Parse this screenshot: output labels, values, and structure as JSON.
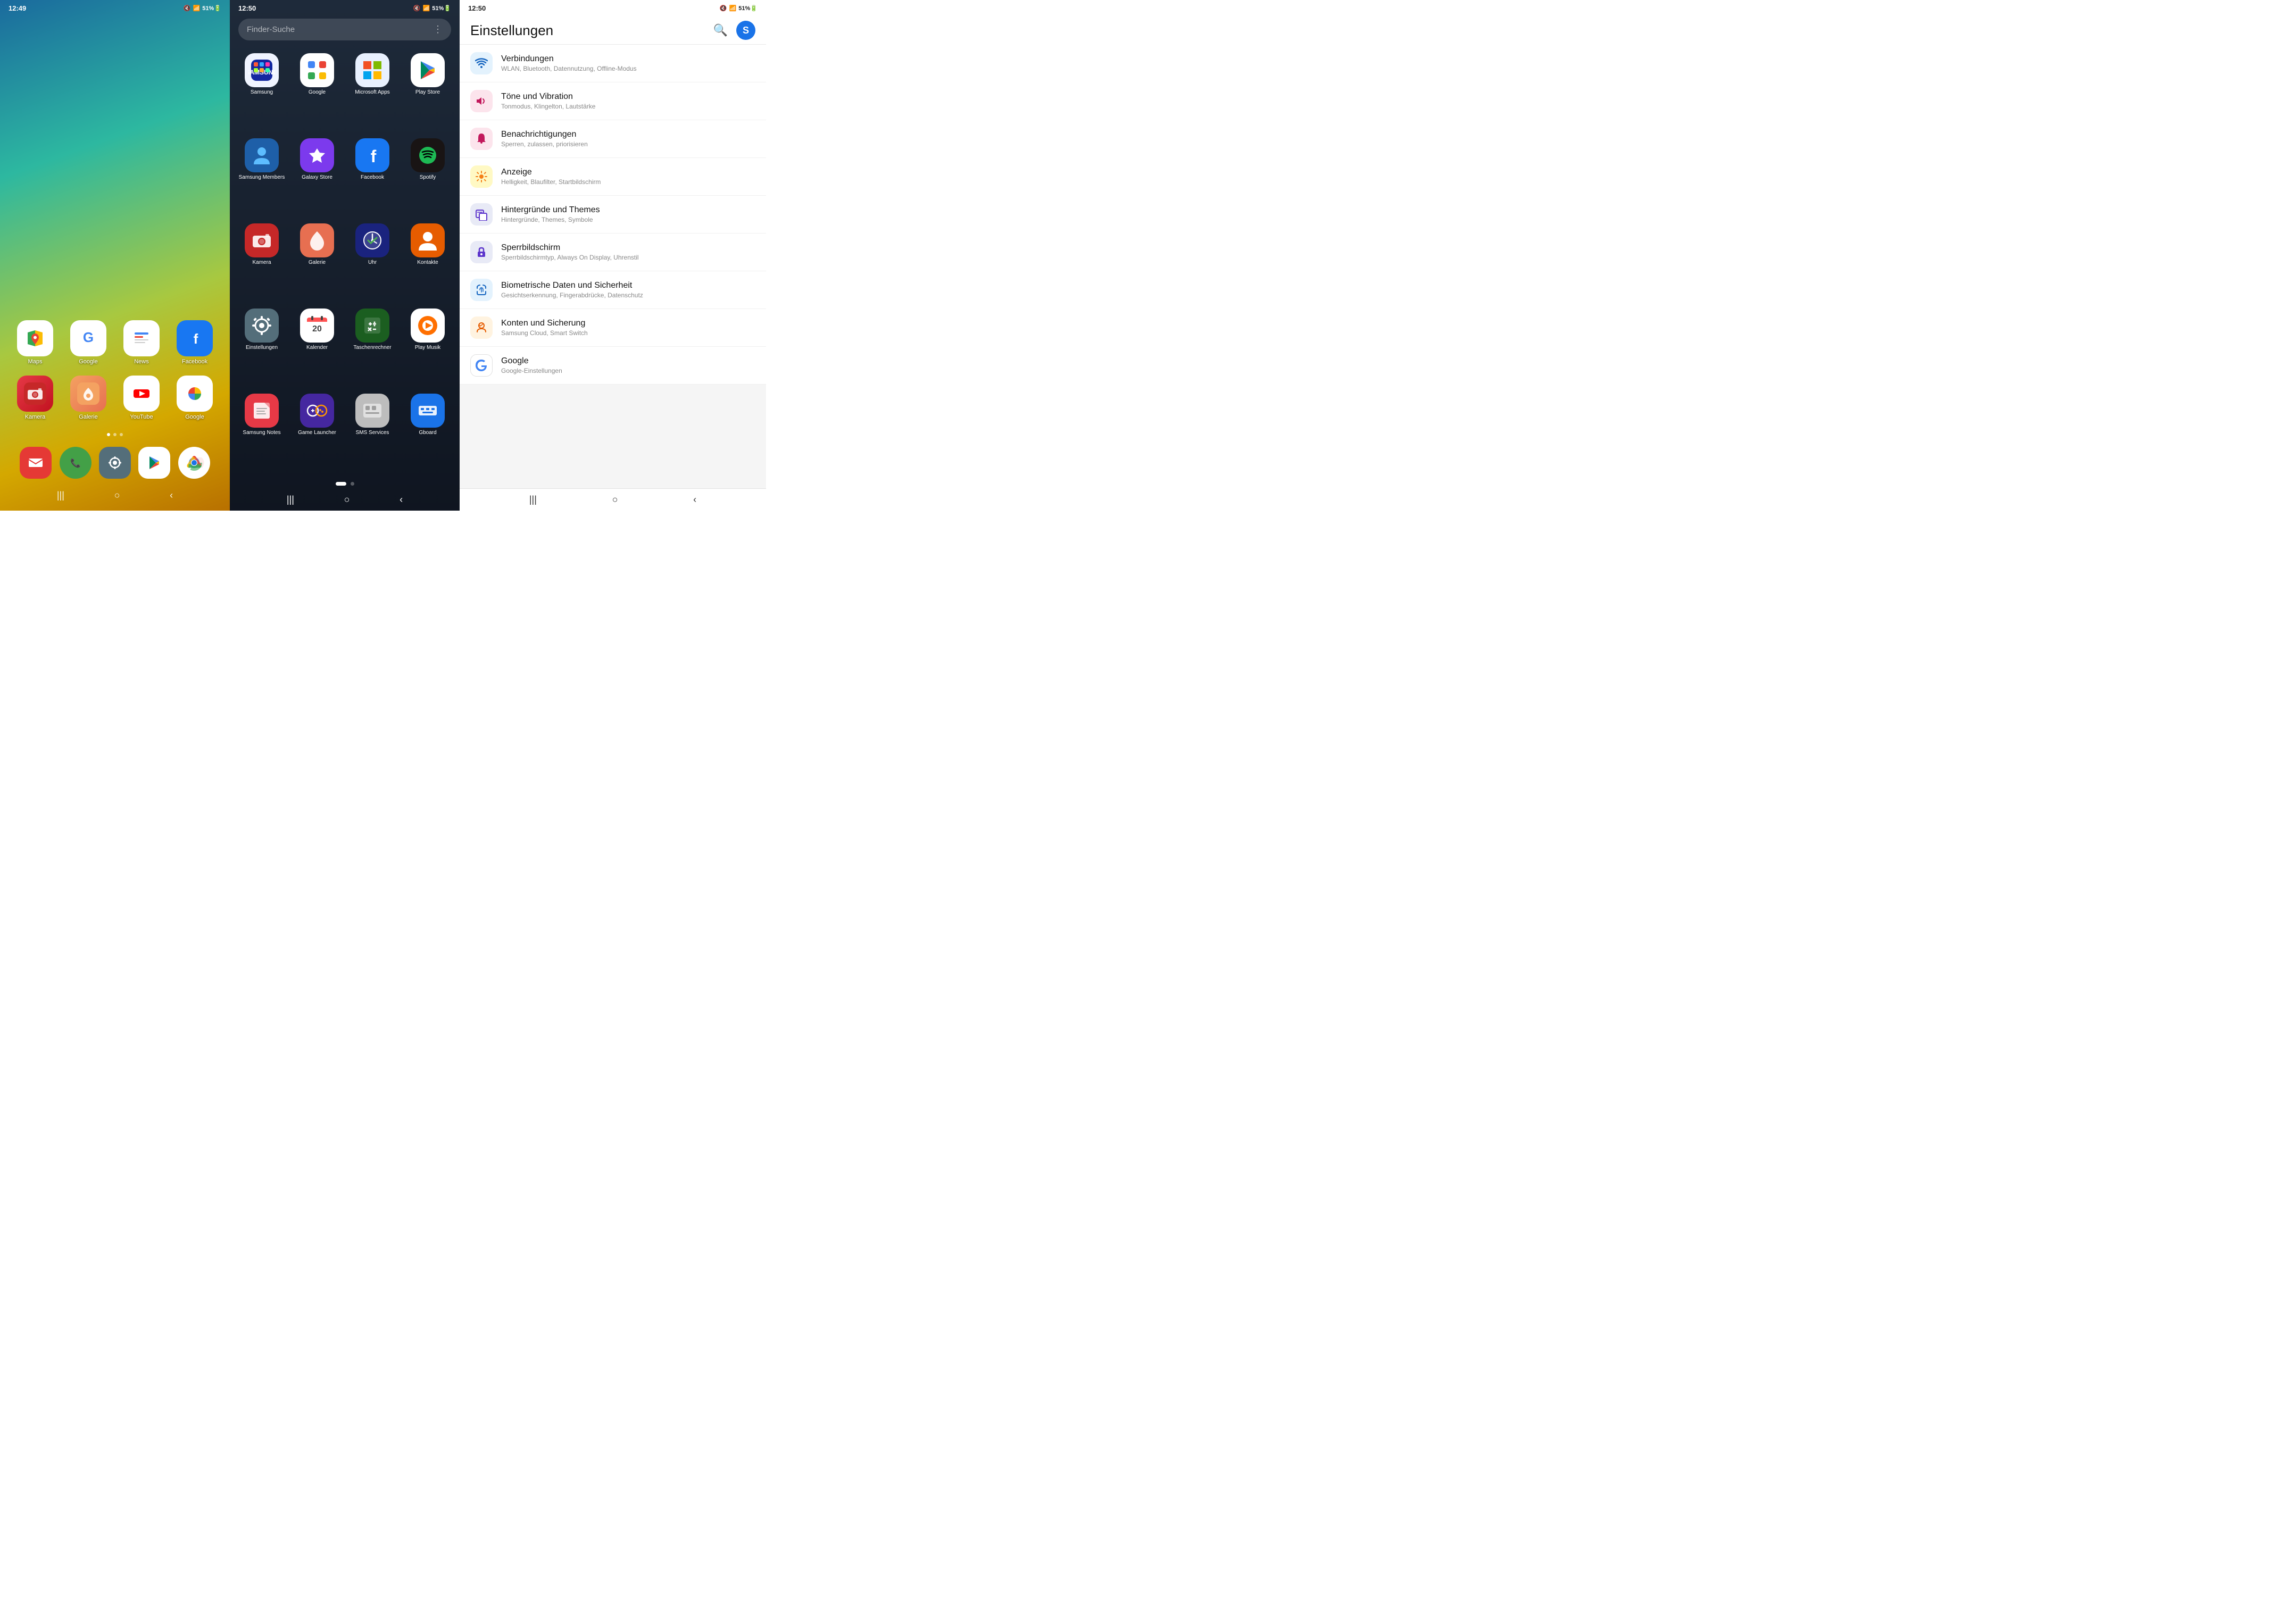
{
  "panel1": {
    "status": {
      "time": "12:49",
      "icons": "🔇 📶 51% 🔋"
    },
    "apps": [
      {
        "label": "Maps",
        "icon": "maps",
        "bg": "#fff"
      },
      {
        "label": "Google",
        "icon": "google",
        "bg": "#fff"
      },
      {
        "label": "News",
        "icon": "news",
        "bg": "#fff"
      },
      {
        "label": "Facebook",
        "icon": "facebook",
        "bg": "#1877f2"
      },
      {
        "label": "Kamera",
        "icon": "kamera",
        "bg": "#e63946"
      },
      {
        "label": "Galerie",
        "icon": "galerie",
        "bg": "#f4a261"
      },
      {
        "label": "YouTube",
        "icon": "youtube",
        "bg": "#fff"
      },
      {
        "label": "Google",
        "icon": "googlephotos",
        "bg": "#fff"
      }
    ],
    "dock": [
      {
        "label": "Mail",
        "icon": "mail",
        "bg": "#e53935"
      },
      {
        "label": "Phone",
        "icon": "phone",
        "bg": "#43a047"
      },
      {
        "label": "Settings",
        "icon": "settings",
        "bg": "#546e7a"
      },
      {
        "label": "Play Store",
        "icon": "playstore",
        "bg": "#fff"
      },
      {
        "label": "Chrome",
        "icon": "chrome",
        "bg": "#fff"
      }
    ],
    "nav": [
      "|||",
      "○",
      "<"
    ]
  },
  "panel2": {
    "status": {
      "time": "12:50",
      "icons": "🔇 📶 51% 🔋"
    },
    "search_placeholder": "Finder-Suche",
    "apps": [
      {
        "label": "Samsung",
        "icon": "samsung",
        "bg": "#f0f4ff"
      },
      {
        "label": "Google",
        "icon": "googleapps",
        "bg": "#fff"
      },
      {
        "label": "Microsoft Apps",
        "icon": "msapps",
        "bg": "#e8f0fe"
      },
      {
        "label": "Play Store",
        "icon": "playstore2",
        "bg": "#fff"
      },
      {
        "label": "Samsung Members",
        "icon": "smembers",
        "bg": "#1e5fa8"
      },
      {
        "label": "Galaxy Store",
        "icon": "galaxystore",
        "bg": "#7c3aed"
      },
      {
        "label": "Facebook",
        "icon": "facebook2",
        "bg": "#1877f2"
      },
      {
        "label": "Spotify",
        "icon": "spotify",
        "bg": "#191414"
      },
      {
        "label": "Kamera",
        "icon": "kamera2",
        "bg": "#c62828"
      },
      {
        "label": "Galerie",
        "icon": "galerie2",
        "bg": "#e76f51"
      },
      {
        "label": "Uhr",
        "icon": "uhr",
        "bg": "#1a237e"
      },
      {
        "label": "Kontakte",
        "icon": "kontakte",
        "bg": "#e65c00"
      },
      {
        "label": "Einstellungen",
        "icon": "einstellungen",
        "bg": "#546e7a"
      },
      {
        "label": "Kalender",
        "icon": "kalender",
        "bg": "#fff"
      },
      {
        "label": "Taschenrechner",
        "icon": "taschenrechner",
        "bg": "#1b5e20"
      },
      {
        "label": "Play Musik",
        "icon": "playmusik",
        "bg": "#fff"
      },
      {
        "label": "Samsung Notes",
        "icon": "snotes",
        "bg": "#e63946"
      },
      {
        "label": "Game Launcher",
        "icon": "gamelauncher",
        "bg": "#4527a0"
      },
      {
        "label": "SMS Services",
        "icon": "smsservices",
        "bg": "#bdbdbd"
      },
      {
        "label": "Gboard",
        "icon": "gboard",
        "bg": "#1a73e8"
      }
    ],
    "nav": [
      "|||",
      "○",
      "<"
    ],
    "dots": [
      true,
      false
    ]
  },
  "panel3": {
    "status": {
      "time": "12:50",
      "icons": "🔇 📶 51% 🔋"
    },
    "title": "Einstellungen",
    "settings": [
      {
        "icon": "wifi",
        "title": "Verbindungen",
        "subtitle": "WLAN, Bluetooth, Datennutzung, Offline-Modus",
        "iconBg": "si-wifi"
      },
      {
        "icon": "sound",
        "title": "Töne und Vibration",
        "subtitle": "Tonmodus, Klingelton, Lautstärke",
        "iconBg": "si-sound"
      },
      {
        "icon": "notif",
        "title": "Benachrichtigungen",
        "subtitle": "Sperren, zulassen, priorisieren",
        "iconBg": "si-notif"
      },
      {
        "icon": "display",
        "title": "Anzeige",
        "subtitle": "Helligkeit, Blaufilter, Startbildschirm",
        "iconBg": "si-display"
      },
      {
        "icon": "wallpaper",
        "title": "Hintergründe und Themes",
        "subtitle": "Hintergründe, Themes, Symbole",
        "iconBg": "si-wallpaper"
      },
      {
        "icon": "lockscreen",
        "title": "Sperrbildschirm",
        "subtitle": "Sperrbildschirmtyp, Always On Display, Uhrenstil",
        "iconBg": "si-lockscreen"
      },
      {
        "icon": "biometric",
        "title": "Biometrische Daten und Sicherheit",
        "subtitle": "Gesichtserkennung, Fingerabdrücke, Datenschutz",
        "iconBg": "si-biometric"
      },
      {
        "icon": "accounts",
        "title": "Konten und Sicherung",
        "subtitle": "Samsung Cloud, Smart Switch",
        "iconBg": "si-accounts"
      },
      {
        "icon": "google",
        "title": "Google",
        "subtitle": "Google-Einstellungen",
        "iconBg": "si-google"
      }
    ],
    "nav": [
      "|||",
      "○",
      "<"
    ]
  }
}
